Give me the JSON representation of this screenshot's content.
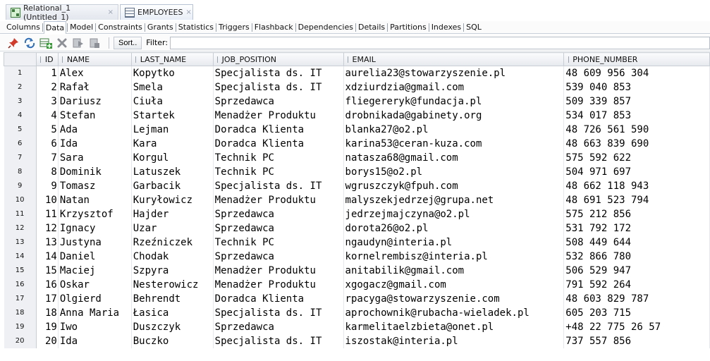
{
  "tabs": [
    {
      "label": "Relational_1 (Untitled_1)",
      "close": "×"
    },
    {
      "label": "EMPLOYEES",
      "close": "×"
    }
  ],
  "subtabs": [
    "Columns",
    "Data",
    "Model",
    "Constraints",
    "Grants",
    "Statistics",
    "Triggers",
    "Flashback",
    "Dependencies",
    "Details",
    "Partitions",
    "Indexes",
    "SQL"
  ],
  "active_subtab": "Data",
  "toolbar": {
    "icons": [
      "pin-icon",
      "refresh-icon",
      "insert-row-icon",
      "delete-row-icon",
      "commit-icon",
      "rollback-icon"
    ],
    "sort_label": "Sort..",
    "filter_label": "Filter:",
    "filter_value": ""
  },
  "columns": [
    "ID",
    "NAME",
    "LAST_NAME",
    "JOB_POSITION",
    "EMAIL",
    "PHONE_NUMBER"
  ],
  "rows": [
    {
      "n": "1",
      "id": "1",
      "name": "Alex",
      "last": "Kopytko",
      "job": "Specjalista ds. IT",
      "email": "aurelia23@stowarzyszenie.pl",
      "phone": "48 609 956 304"
    },
    {
      "n": "2",
      "id": "2",
      "name": "Rafał",
      "last": "Smela",
      "job": "Specjalista ds. IT",
      "email": "xdziurdzia@gmail.com",
      "phone": "539 040 853"
    },
    {
      "n": "3",
      "id": "3",
      "name": "Dariusz",
      "last": "Ciuła",
      "job": "Sprzedawca",
      "email": "fliegereryk@fundacja.pl",
      "phone": "509 339 857"
    },
    {
      "n": "4",
      "id": "4",
      "name": "Stefan",
      "last": "Startek",
      "job": "Menadżer Produktu",
      "email": "drobnikada@gabinety.org",
      "phone": "534 017 853"
    },
    {
      "n": "5",
      "id": "5",
      "name": "Ada",
      "last": "Lejman",
      "job": "Doradca Klienta",
      "email": "blanka27@o2.pl",
      "phone": "48 726 561 590"
    },
    {
      "n": "6",
      "id": "6",
      "name": "Ida",
      "last": "Kara",
      "job": "Doradca Klienta",
      "email": "karina53@ceran-kuza.com",
      "phone": "48 663 839 690"
    },
    {
      "n": "7",
      "id": "7",
      "name": "Sara",
      "last": "Korgul",
      "job": "Technik PC",
      "email": "natasza68@gmail.com",
      "phone": "575 592 622"
    },
    {
      "n": "8",
      "id": "8",
      "name": "Dominik",
      "last": "Latuszek",
      "job": "Technik PC",
      "email": "borys15@o2.pl",
      "phone": "504 971 697"
    },
    {
      "n": "9",
      "id": "9",
      "name": "Tomasz",
      "last": "Garbacik",
      "job": "Specjalista ds. IT",
      "email": "wgruszczyk@fpuh.com",
      "phone": "48 662 118 943"
    },
    {
      "n": "10",
      "id": "10",
      "name": "Natan",
      "last": "Kuryłowicz",
      "job": "Menadżer Produktu",
      "email": "malyszekjedrzej@grupa.net",
      "phone": "48 691 523 794"
    },
    {
      "n": "11",
      "id": "11",
      "name": "Krzysztof",
      "last": "Hajder",
      "job": "Sprzedawca",
      "email": "jedrzejmajczyna@o2.pl",
      "phone": "575 212 856"
    },
    {
      "n": "12",
      "id": "12",
      "name": "Ignacy",
      "last": "Uzar",
      "job": "Sprzedawca",
      "email": "dorota26@o2.pl",
      "phone": "531 792 172"
    },
    {
      "n": "13",
      "id": "13",
      "name": "Justyna",
      "last": "Rzeźniczek",
      "job": "Technik PC",
      "email": "ngaudyn@interia.pl",
      "phone": "508 449 644"
    },
    {
      "n": "14",
      "id": "14",
      "name": "Daniel",
      "last": "Chodak",
      "job": "Sprzedawca",
      "email": "kornelrembisz@interia.pl",
      "phone": "532 866 780"
    },
    {
      "n": "15",
      "id": "15",
      "name": "Maciej",
      "last": "Szpyra",
      "job": "Menadżer Produktu",
      "email": "anitabilik@gmail.com",
      "phone": "506 529 947"
    },
    {
      "n": "16",
      "id": "16",
      "name": "Oskar",
      "last": "Nesterowicz",
      "job": "Menadżer Produktu",
      "email": "xgogacz@gmail.com",
      "phone": "791 592 264"
    },
    {
      "n": "17",
      "id": "17",
      "name": "Olgierd",
      "last": "Behrendt",
      "job": "Doradca Klienta",
      "email": "rpacyga@stowarzyszenie.com",
      "phone": "48 603 829 787"
    },
    {
      "n": "18",
      "id": "18",
      "name": "Anna Maria",
      "last": "Łasica",
      "job": "Specjalista ds. IT",
      "email": "aprochownik@rubacha-wieladek.pl",
      "phone": "605 203 715"
    },
    {
      "n": "19",
      "id": "19",
      "name": "Iwo",
      "last": "Duszczyk",
      "job": "Sprzedawca",
      "email": "karmelitaelzbieta@onet.pl",
      "phone": "+48 22 775 26 57"
    },
    {
      "n": "20",
      "id": "20",
      "name": "Ida",
      "last": "Buczko",
      "job": "Specjalista ds. IT",
      "email": "iszostak@interia.pl",
      "phone": "737 557 856"
    }
  ]
}
